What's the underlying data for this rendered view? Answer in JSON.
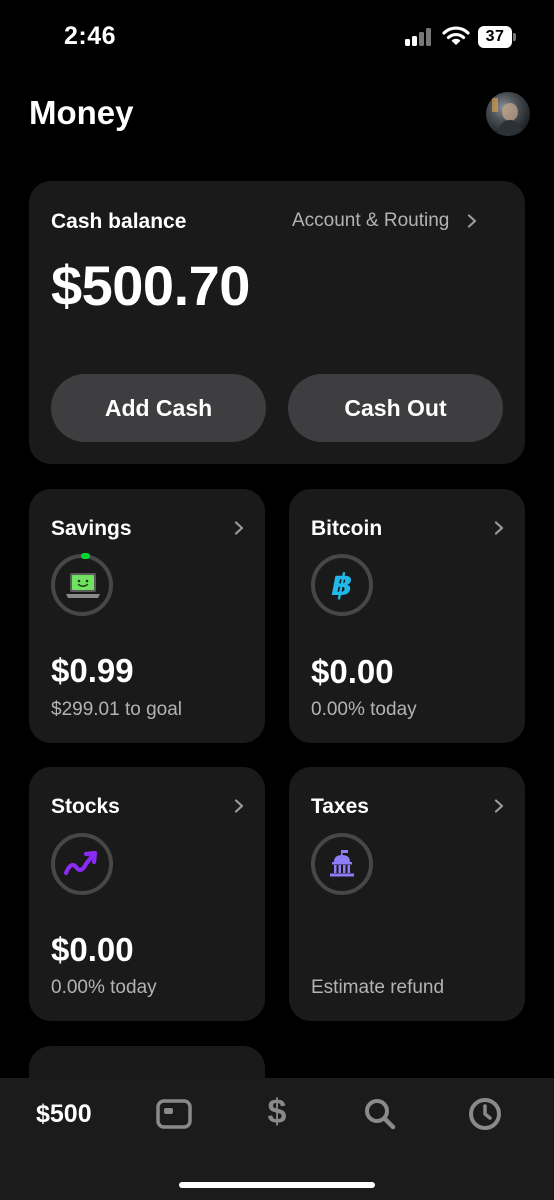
{
  "status_bar": {
    "time": "2:46",
    "battery": "37"
  },
  "header": {
    "title": "Money"
  },
  "cash_card": {
    "label": "Cash balance",
    "link": "Account & Routing",
    "balance": "$500.70",
    "add_cash": "Add Cash",
    "cash_out": "Cash Out"
  },
  "savings": {
    "label": "Savings",
    "amount": "$0.99",
    "sub": "$299.01 to goal"
  },
  "bitcoin": {
    "label": "Bitcoin",
    "amount": "$0.00",
    "sub": "0.00% today",
    "icon": "bitcoin-icon",
    "color": "#1fb8e8"
  },
  "stocks": {
    "label": "Stocks",
    "amount": "$0.00",
    "sub": "0.00% today",
    "icon": "stocks-trend-icon",
    "color": "#8b2cf5"
  },
  "taxes": {
    "label": "Taxes",
    "sub": "Estimate refund",
    "icon": "capitol-building-icon",
    "color": "#8f7cf7"
  },
  "tab_bar": {
    "money_amount": "$500"
  },
  "colors": {
    "background": "#000000",
    "card": "#1a1a1a",
    "button": "#3e3e40",
    "savings_accent": "#00d632"
  }
}
